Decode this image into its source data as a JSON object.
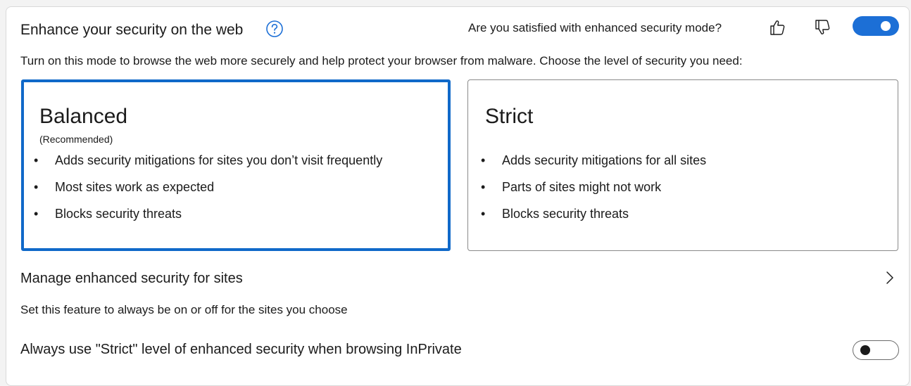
{
  "header": {
    "title": "Enhance your security on the web",
    "feedback_question": "Are you satisfied with enhanced security mode?",
    "help_icon": "help-circle-icon",
    "thumbs_up_icon": "thumbs-up-icon",
    "thumbs_down_icon": "thumbs-down-icon",
    "toggle_state": "on"
  },
  "description": "Turn on this mode to browse the web more securely and help protect your browser from malware. Choose the level of security you need:",
  "options": [
    {
      "title": "Balanced",
      "subtitle": "(Recommended)",
      "selected": true,
      "bullets": [
        "Adds security mitigations for sites you don’t visit frequently",
        "Most sites work as expected",
        "Blocks security threats"
      ]
    },
    {
      "title": "Strict",
      "subtitle": "",
      "selected": false,
      "bullets": [
        "Adds security mitigations for all sites",
        "Parts of sites might not work",
        "Blocks security threats"
      ]
    }
  ],
  "bullet_char": "•",
  "manage": {
    "title": "Manage enhanced security for sites",
    "subtitle": "Set this feature to always be on or off for the sites you choose",
    "icon": "chevron-right-icon"
  },
  "inprivate": {
    "title": "Always use \"Strict\" level of enhanced security when browsing InPrivate",
    "toggle_state": "off"
  },
  "colors": {
    "accent": "#1c6fd6",
    "selected_border": "#1069c9",
    "text": "#1b1b1b",
    "card_bg": "#ffffff",
    "page_bg": "#f3f3f3"
  }
}
